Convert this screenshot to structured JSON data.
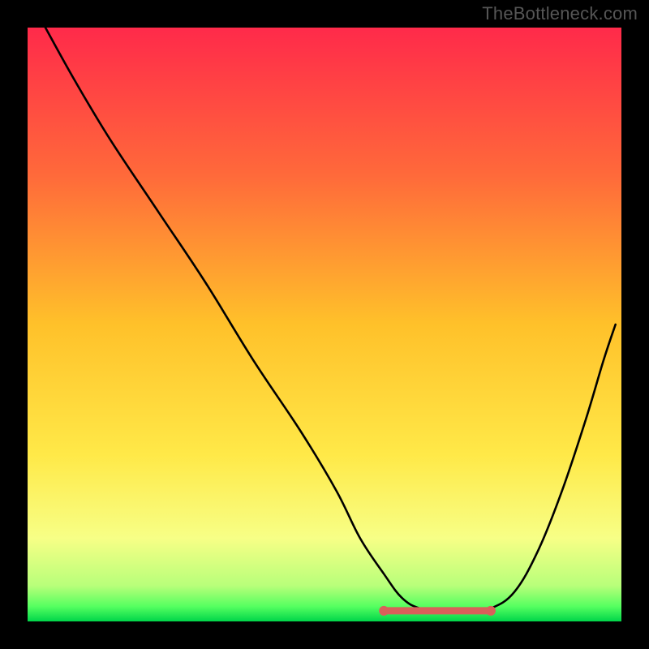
{
  "watermark": "TheBottleneck.com",
  "chart_data": {
    "type": "line",
    "title": "",
    "xlabel": "",
    "ylabel": "",
    "xlim": [
      0,
      100
    ],
    "ylim": [
      0,
      100
    ],
    "grid": false,
    "background_gradient_stops": [
      {
        "offset": 0.0,
        "color": "#ff2a4a"
      },
      {
        "offset": 0.25,
        "color": "#ff6a3a"
      },
      {
        "offset": 0.5,
        "color": "#ffc12a"
      },
      {
        "offset": 0.72,
        "color": "#ffe948"
      },
      {
        "offset": 0.86,
        "color": "#f7ff86"
      },
      {
        "offset": 0.94,
        "color": "#b8ff7a"
      },
      {
        "offset": 0.975,
        "color": "#55ff60"
      },
      {
        "offset": 1.0,
        "color": "#00d54a"
      }
    ],
    "series": [
      {
        "name": "bottleneck-curve",
        "color": "#000000",
        "x": [
          3,
          8,
          14,
          22,
          30,
          38,
          46,
          52,
          56,
          60,
          63,
          66,
          70,
          74,
          78,
          82,
          86,
          90,
          94,
          97,
          99
        ],
        "y": [
          100,
          91,
          81,
          69,
          57,
          44,
          32,
          22,
          14,
          8,
          4,
          2.2,
          1.6,
          1.6,
          2.2,
          5,
          12,
          22,
          34,
          44,
          50
        ]
      }
    ],
    "flat_segment": {
      "color": "#d9605a",
      "x_range": [
        60,
        78
      ],
      "y": 1.8,
      "endpoint_radius": 0.9
    }
  }
}
